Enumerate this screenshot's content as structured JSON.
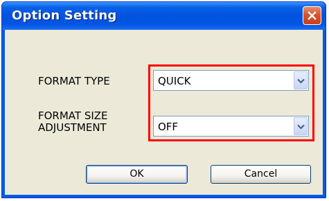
{
  "window": {
    "title": "Option Setting",
    "close_icon": "close-icon"
  },
  "fields": [
    {
      "label": "FORMAT TYPE",
      "value": "QUICK"
    },
    {
      "label": "FORMAT SIZE\nADJUSTMENT",
      "value": "OFF"
    }
  ],
  "buttons": {
    "ok_label": "OK",
    "cancel_label": "Cancel"
  },
  "colors": {
    "highlight_frame": "#ff0000",
    "title_bar": "#0155e3",
    "client_background": "#ece9d8"
  }
}
